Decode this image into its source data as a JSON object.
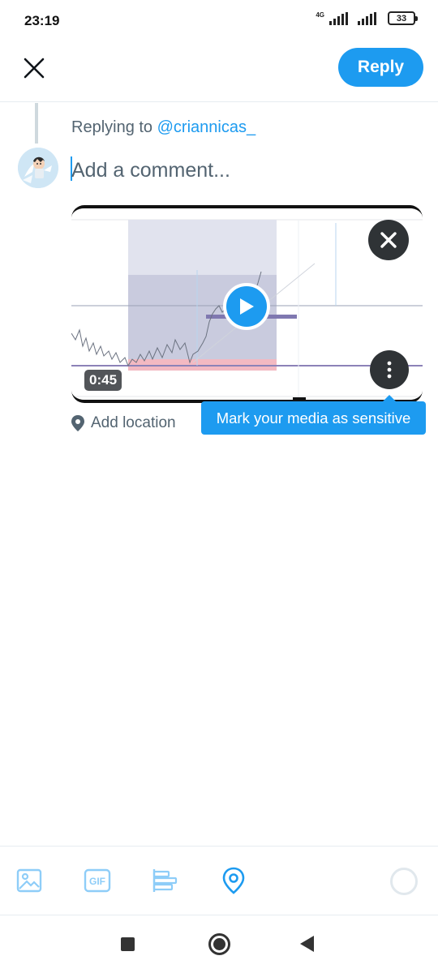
{
  "status_bar": {
    "time": "23:19",
    "network": "4G",
    "battery": "33"
  },
  "header": {
    "close_icon": "close-icon",
    "reply_label": "Reply"
  },
  "compose": {
    "replying_prefix": "Replying to",
    "replying_handle": "@criannicas_",
    "placeholder": "Add a comment..."
  },
  "media": {
    "duration": "0:45",
    "remove_icon": "close-icon",
    "more_icon": "more-vertical-icon",
    "play_icon": "play-icon"
  },
  "tooltip": {
    "text": "Mark your media as sensitive"
  },
  "location": {
    "label": "Add location",
    "icon": "location-pin-icon"
  },
  "toolbar": {
    "items": [
      "image-icon",
      "gif-icon",
      "poll-icon",
      "location-icon"
    ],
    "gif_label": "GIF",
    "accent_color": "#1d9bf0",
    "muted_color": "#8ecdf8"
  },
  "nav": {
    "items": [
      "recents-icon",
      "home-icon",
      "back-icon"
    ]
  }
}
